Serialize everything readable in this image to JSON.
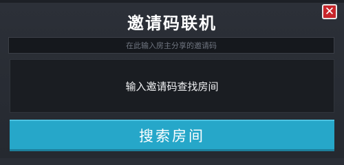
{
  "dialog": {
    "title": "邀请码联机",
    "close_icon": "close-icon",
    "input": {
      "value": "",
      "placeholder": "在此输入房主分享的邀请码"
    },
    "result_panel": {
      "message": "输入邀请码查找房间"
    },
    "search_button": {
      "label": "搜索房间"
    }
  },
  "colors": {
    "accent": "#26a7c9",
    "close": "#c8262b",
    "background": "#2a2e36"
  }
}
